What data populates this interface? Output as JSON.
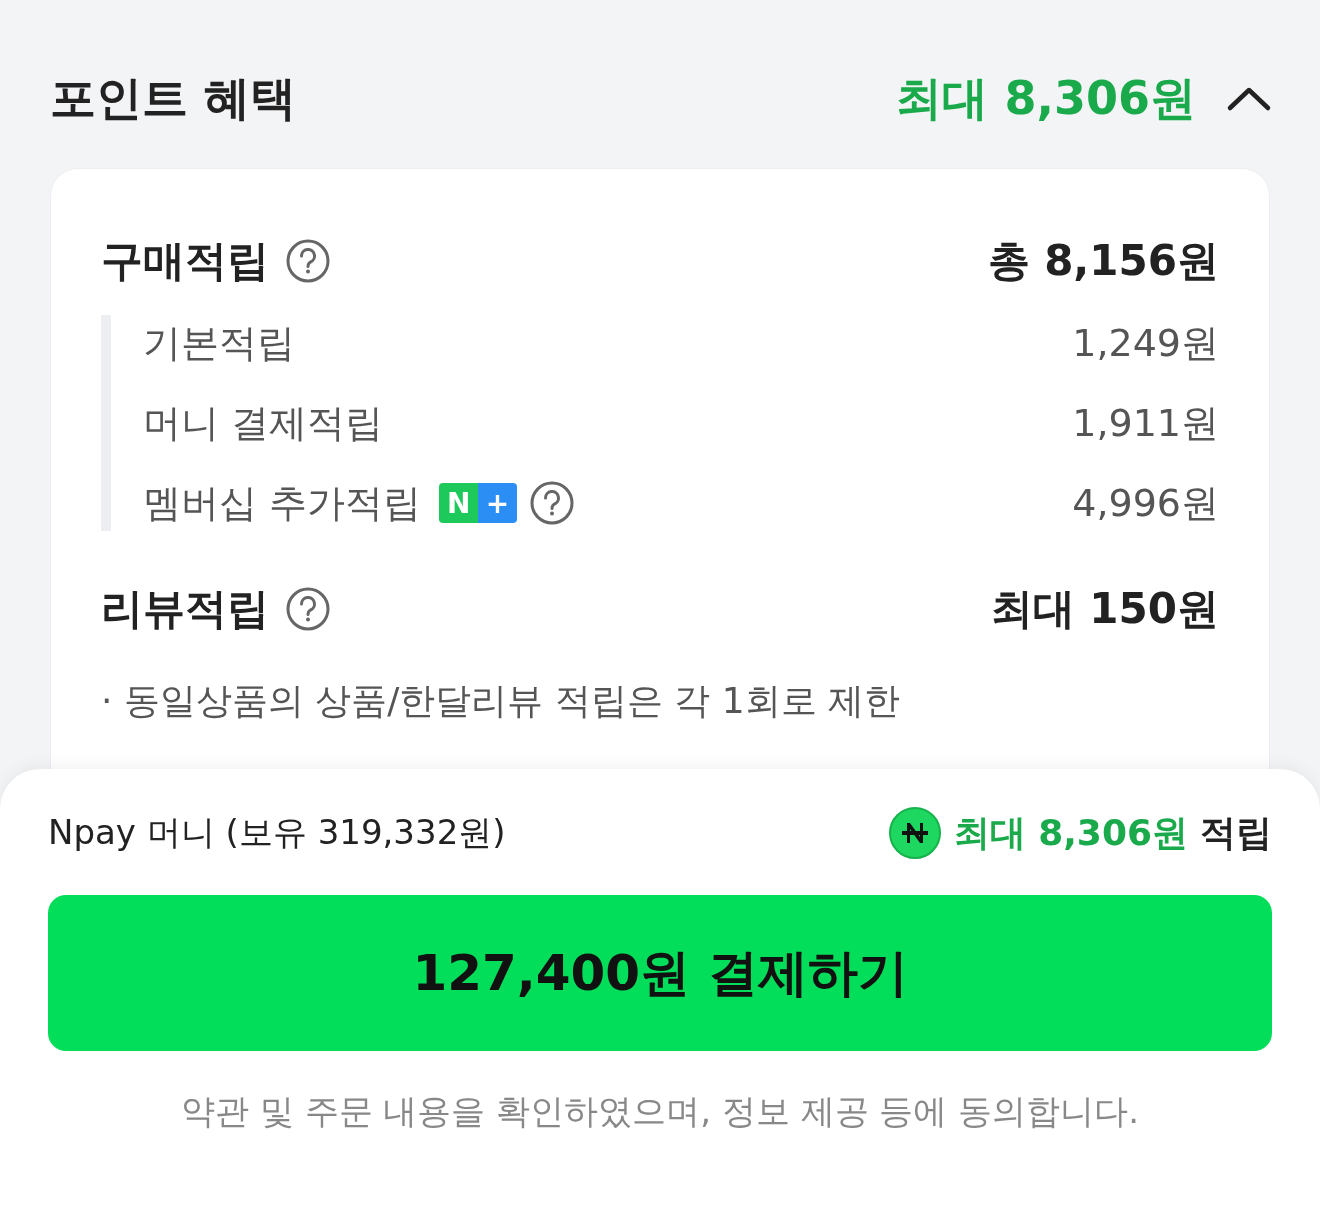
{
  "header": {
    "title": "포인트 혜택",
    "total": "최대 8,306원",
    "expanded": true
  },
  "purchase": {
    "title": "구매적립",
    "total": "총 8,156원",
    "items": [
      {
        "kind": "plain",
        "label": "기본적립",
        "amount": "1,249원"
      },
      {
        "kind": "plain",
        "label": "머니 결제적립",
        "amount": "1,911원"
      },
      {
        "kind": "membership",
        "label": "멤버십 추가적립",
        "badge": [
          "N",
          "+"
        ],
        "amount": "4,996원"
      }
    ]
  },
  "review": {
    "title": "리뷰적립",
    "total": "최대 150원",
    "note": "· 동일상품의 상품/한달리뷰 적립은 각 1회로 제한"
  },
  "payment": {
    "method": "Npay 머니 (보유 319,332원)",
    "accrual_amount": "최대 8,306원",
    "accrual_suffix": "적립",
    "button": "127,400원 결제하기",
    "terms": "약관 및 주문 내용을 확인하였으며, 정보 제공 등에 동의합니다."
  }
}
